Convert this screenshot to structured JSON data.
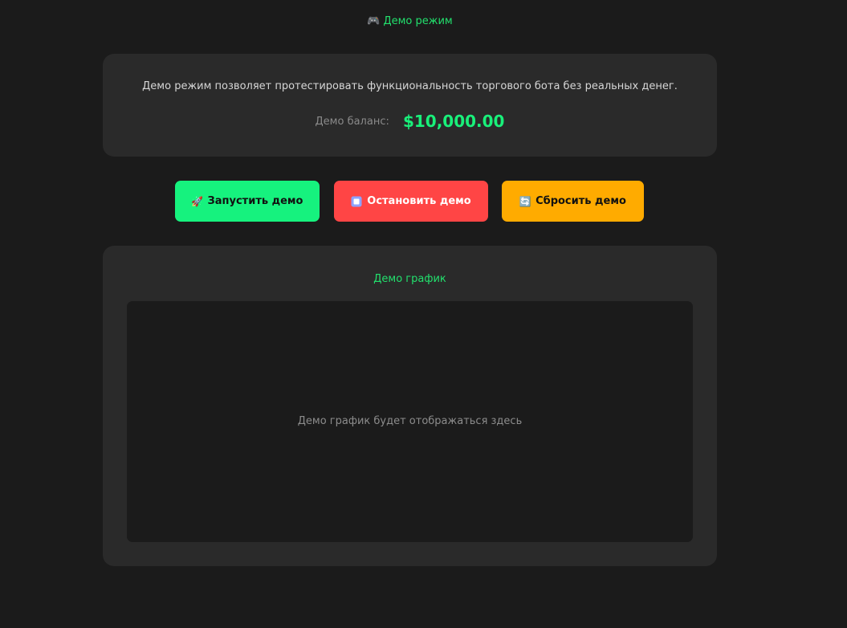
{
  "header": {
    "icon": "gamepad-icon",
    "icon_glyph": "🎮",
    "title": "Демо режим"
  },
  "info": {
    "description": "Демо режим позволяет протестировать функциональность торгового бота без реальных денег.",
    "balance_label": "Демо баланс:",
    "balance_value": "$10,000.00"
  },
  "actions": {
    "start": {
      "icon": "rocket-icon",
      "icon_glyph": "🚀",
      "label": "Запустить демо",
      "color": "#16f27e"
    },
    "stop": {
      "icon": "stop-square-icon",
      "label": "Остановить демо",
      "color": "#ff4545"
    },
    "reset": {
      "icon": "refresh-icon",
      "icon_glyph": "🔄",
      "label": "Сбросить демо",
      "color": "#ffab00"
    }
  },
  "chart": {
    "title": "Демо график",
    "placeholder": "Демо график будет отображаться здесь"
  },
  "colors": {
    "background": "#1b1b1b",
    "card": "#2a2a2a",
    "accent": "#22e06d",
    "balance": "#19f07a"
  }
}
